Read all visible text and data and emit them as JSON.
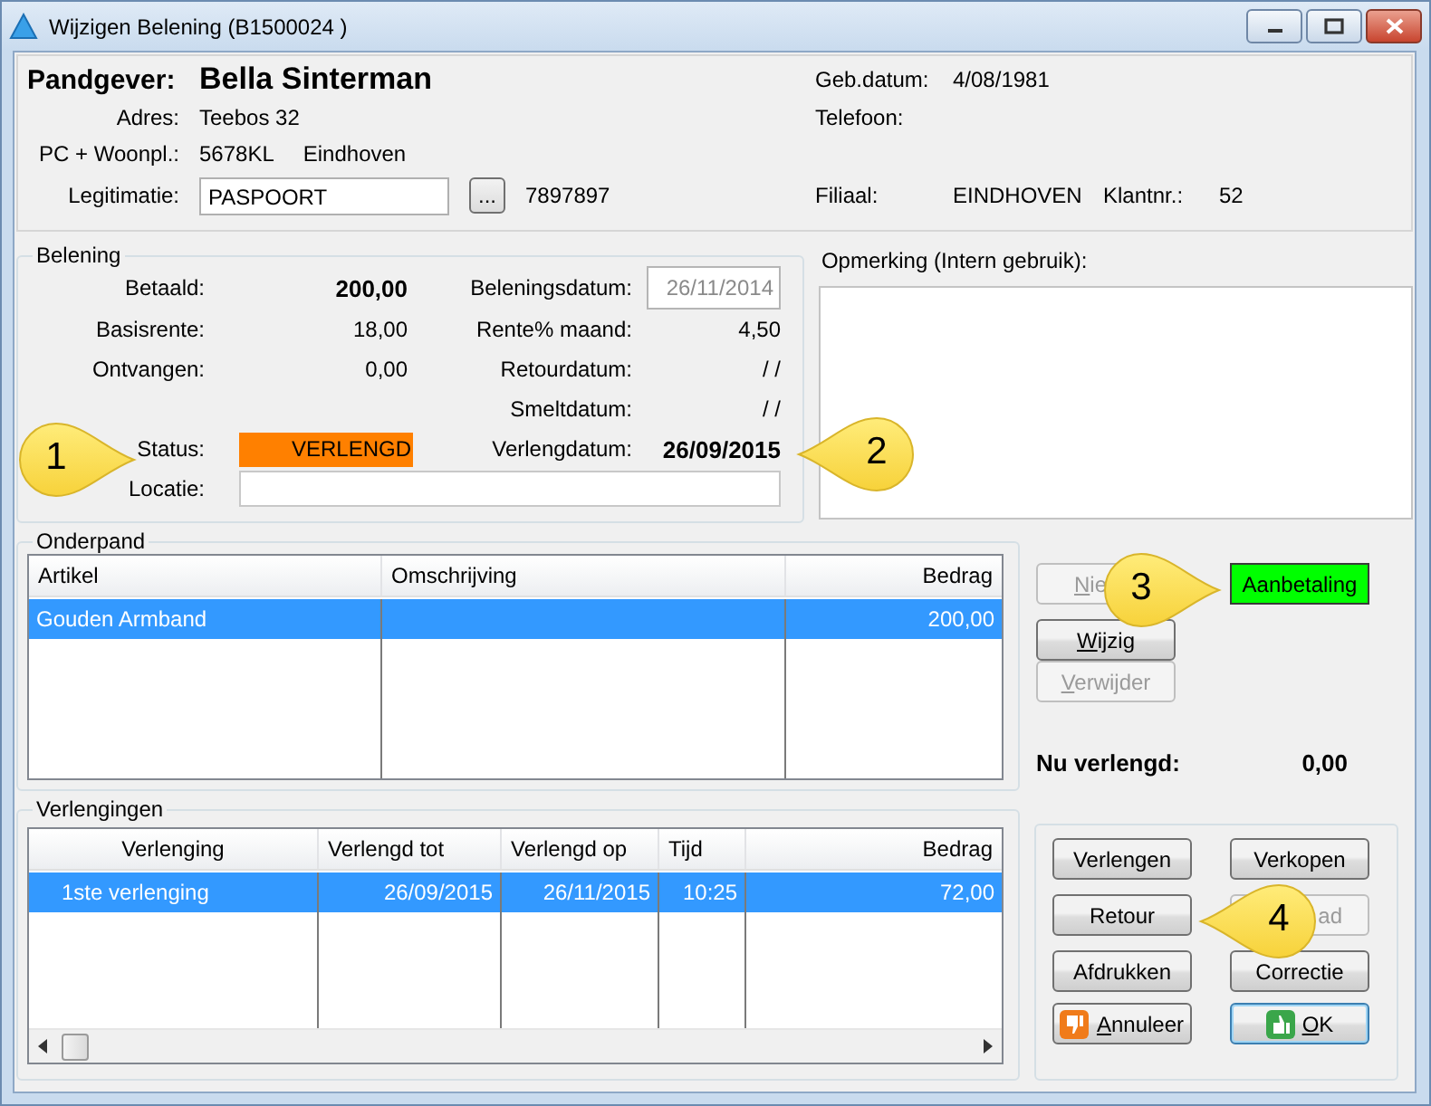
{
  "window": {
    "title": "Wijzigen Belening  (B1500024  )"
  },
  "client": {
    "pandgever_label": "Pandgever:",
    "pandgever": "Bella Sinterman",
    "rows": [
      {
        "label": "Adres:",
        "values": [
          "Teebos 32"
        ]
      },
      {
        "label": "PC + Woonpl.:",
        "values": [
          "5678KL",
          "Eindhoven"
        ]
      }
    ],
    "legitimatie": {
      "label": "Legitimatie:",
      "value": "PASPOORT",
      "button": "...",
      "number": "7897897"
    },
    "right_rows": [
      {
        "label": "Geb.datum:",
        "values": [
          "4/08/1981"
        ]
      },
      {
        "label": "Telefoon:",
        "values": []
      }
    ],
    "filiaal": {
      "label": "Filiaal:",
      "value": "EINDHOVEN",
      "klant_label": "Klantnr.:",
      "klant": "52"
    }
  },
  "belening": {
    "title": "Belening",
    "rows": [
      {
        "left": {
          "label": "Betaald:",
          "value": "200,00",
          "kind": "bold"
        },
        "right": {
          "label": "Beleningsdatum:",
          "value": "26/11/2014",
          "kind": "field",
          "disabled": true
        }
      },
      {
        "left": {
          "label": "Basisrente:",
          "value": "18,00",
          "kind": "text"
        },
        "right": {
          "label": "Rente% maand:",
          "value": "4,50",
          "kind": "text"
        }
      },
      {
        "left": {
          "label": "Ontvangen:",
          "value": "0,00",
          "kind": "text"
        },
        "right": {
          "label": "Retourdatum:",
          "value": "/ /",
          "kind": "text"
        }
      },
      {
        "right": {
          "label": "Smeltdatum:",
          "value": "/ /",
          "kind": "text"
        }
      },
      {
        "left": {
          "label": "Status:",
          "value": "VERLENGD",
          "kind": "status",
          "color": "#ff8000"
        },
        "right": {
          "label": "Verlengdatum:",
          "value": "26/09/2015",
          "kind": "bold"
        }
      },
      {
        "left": {
          "label": "Locatie:",
          "kind": "input"
        }
      }
    ]
  },
  "opmerking": {
    "label": "Opmerking (Intern gebruik):"
  },
  "onderpand": {
    "title": "Onderpand",
    "columns": [
      {
        "label": "Artikel"
      },
      {
        "label": "Omschrijving"
      },
      {
        "label": "Bedrag"
      }
    ],
    "rows": [
      {
        "selected": true,
        "cells": [
          "Gouden Armband",
          null,
          "200,00"
        ]
      }
    ]
  },
  "side_buttons": [
    {
      "key": "N",
      "rest": "ie",
      "disabled": true,
      "clipped": true
    },
    {
      "key": "W",
      "rest": "ijzig",
      "disabled": false,
      "clipped": false
    },
    {
      "key": "V",
      "rest": "erwijder",
      "disabled": true,
      "clipped": false
    }
  ],
  "aanbetaling": {
    "label": "Aanbetaling"
  },
  "nu_verlengd": {
    "label": "Nu verlengd:",
    "value": "0,00"
  },
  "verlengingen": {
    "title": "Verlengingen",
    "columns": [
      {
        "label": "Verlenging"
      },
      {
        "label": "Verlengd tot"
      },
      {
        "label": "Verlengd op"
      },
      {
        "label": "Tijd"
      },
      {
        "label": "Bedrag"
      }
    ],
    "rows": [
      {
        "selected": true,
        "cells": [
          "1ste verlenging",
          "26/09/2015",
          "26/11/2015",
          "10:25",
          "72,00"
        ]
      }
    ]
  },
  "action_buttons": [
    {
      "label": "Verlengen",
      "disabled": false,
      "clipped": false,
      "focused": false
    },
    {
      "label": "Verkopen",
      "disabled": false,
      "clipped": false,
      "focused": false
    },
    {
      "label": "Retour",
      "disabled": false,
      "clipped": false,
      "focused": false
    },
    {
      "label": "ad",
      "disabled": true,
      "clipped": true,
      "focused": false
    },
    {
      "label": "Afdrukken",
      "disabled": false,
      "clipped": false,
      "focused": false
    },
    {
      "label": "Correctie",
      "disabled": false,
      "clipped": false,
      "focused": false
    },
    {
      "key": "A",
      "rest": "nnuleer",
      "kind": "cancel",
      "disabled": false,
      "clipped": false,
      "focused": false
    },
    {
      "key": "O",
      "rest": "K",
      "kind": "confirm",
      "disabled": false,
      "clipped": false,
      "focused": true
    }
  ],
  "callouts": [
    {
      "number": "1"
    },
    {
      "number": "2"
    },
    {
      "number": "3"
    },
    {
      "number": "4"
    }
  ]
}
